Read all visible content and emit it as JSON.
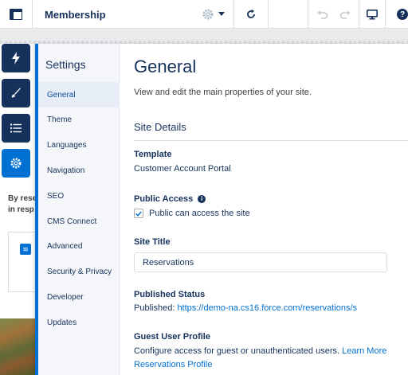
{
  "topbar": {
    "site_name": "Membership",
    "help_label": "?"
  },
  "left_rail": {
    "items": [
      {
        "icon": "lightning-icon",
        "state": "dark"
      },
      {
        "icon": "paintbrush-icon",
        "state": "dark"
      },
      {
        "icon": "list-icon",
        "state": "dark"
      },
      {
        "icon": "gear-icon",
        "state": "active"
      }
    ]
  },
  "preview": {
    "line1": "By rese",
    "line2": "in resp"
  },
  "settings": {
    "title": "Settings",
    "nav_items": [
      {
        "label": "General",
        "active": true
      },
      {
        "label": "Theme",
        "active": false
      },
      {
        "label": "Languages",
        "active": false
      },
      {
        "label": "Navigation",
        "active": false
      },
      {
        "label": "SEO",
        "active": false
      },
      {
        "label": "CMS Connect",
        "active": false
      },
      {
        "label": "Advanced",
        "active": false
      },
      {
        "label": "Security & Privacy",
        "active": false
      },
      {
        "label": "Developer",
        "active": false
      },
      {
        "label": "Updates",
        "active": false
      }
    ]
  },
  "general": {
    "title": "General",
    "description": "View and edit the main properties of your site.",
    "section_title": "Site Details",
    "template_label": "Template",
    "template_value": "Customer Account Portal",
    "public_access_label": "Public Access",
    "public_access_checkbox_label": "Public can access the site",
    "public_access_checked": true,
    "site_title_label": "Site Title",
    "site_title_value": "Reservations",
    "published_status_label": "Published Status",
    "published_prefix": "Published:",
    "published_url": "https://demo-na.cs16.force.com/reservations/s",
    "guest_profile_label": "Guest User Profile",
    "guest_profile_desc": "Configure access for guest or unauthenticated users.",
    "learn_more_label": "Learn More",
    "guest_profile_link": "Reservations Profile"
  },
  "colors": {
    "brand_blue": "#0070d2",
    "dark_navy": "#16325c",
    "text_primary": "#16325c"
  }
}
